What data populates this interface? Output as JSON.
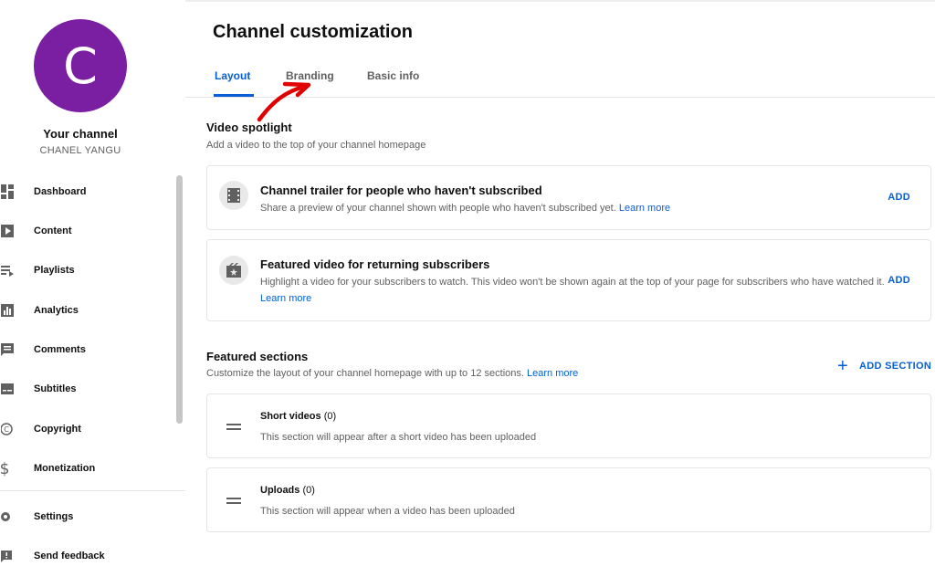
{
  "sidebar": {
    "avatar_letter": "C",
    "channel_name": "Your channel",
    "channel_handle": "CHANEL YANGU",
    "items": [
      {
        "label": "Dashboard",
        "icon": "dashboard-icon"
      },
      {
        "label": "Content",
        "icon": "content-icon"
      },
      {
        "label": "Playlists",
        "icon": "playlists-icon"
      },
      {
        "label": "Analytics",
        "icon": "analytics-icon"
      },
      {
        "label": "Comments",
        "icon": "comments-icon"
      },
      {
        "label": "Subtitles",
        "icon": "subtitles-icon"
      },
      {
        "label": "Copyright",
        "icon": "copyright-icon"
      },
      {
        "label": "Monetization",
        "icon": "monetization-icon"
      }
    ],
    "bottom_items": [
      {
        "label": "Settings",
        "icon": "gear-icon"
      },
      {
        "label": "Send feedback",
        "icon": "feedback-icon"
      }
    ]
  },
  "main": {
    "title": "Channel customization",
    "tabs": [
      {
        "label": "Layout",
        "active": true
      },
      {
        "label": "Branding",
        "active": false
      },
      {
        "label": "Basic info",
        "active": false
      }
    ],
    "video_spotlight": {
      "title": "Video spotlight",
      "description": "Add a video to the top of your channel homepage",
      "cards": [
        {
          "title": "Channel trailer for people who haven't subscribed",
          "description": "Share a preview of your channel shown with people who haven't subscribed yet.",
          "link": "Learn more",
          "action": "ADD"
        },
        {
          "title": "Featured video for returning subscribers",
          "description": "Highlight a video for your subscribers to watch. This video won't be shown again at the top of your page for subscribers who have watched it.",
          "link": "Learn more",
          "action": "ADD"
        }
      ]
    },
    "featured_sections": {
      "title": "Featured sections",
      "description": "Customize the layout of your channel homepage with up to 12 sections.",
      "link": "Learn more",
      "add_section_label": "ADD SECTION",
      "sections": [
        {
          "name": "Short videos",
          "count": "(0)",
          "description": "This section will appear after a short video has been uploaded"
        },
        {
          "name": "Uploads",
          "count": "(0)",
          "description": "This section will appear when a video has been uploaded"
        }
      ]
    }
  },
  "colors": {
    "accent": "#065fd4",
    "avatar": "#7b1fa2",
    "annotation": "#e00000"
  }
}
